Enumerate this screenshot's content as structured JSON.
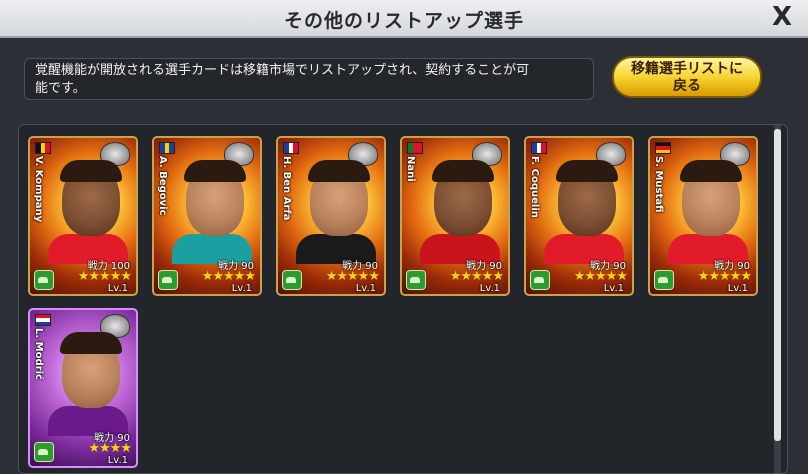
{
  "header": {
    "title": "その他のリストアップ選手",
    "close_label": "X"
  },
  "info": {
    "text_line1": "覚醒機能が開放される選手カードは移籍市場でリストアップされ、契約することが可",
    "text_line2": "能です。"
  },
  "back_button": {
    "line1": "移籍選手リストに",
    "line2": "戻る"
  },
  "cards": [
    {
      "name": "V. Kompany",
      "power": "戦力 100",
      "stars": "★★★★★",
      "level": "Lv.1",
      "flag": [
        "#111111",
        "#f5d400",
        "#e0102a"
      ],
      "flag_dir": "v",
      "style": "gold",
      "skin": "dark",
      "shirt": "#e21b2a"
    },
    {
      "name": "A. Begovic",
      "power": "戦力 90",
      "stars": "★★★★★",
      "level": "Lv.1",
      "flag": [
        "#1c3ea0",
        "#f5d400",
        "#1c3ea0"
      ],
      "flag_dir": "v",
      "style": "gold",
      "skin": "light",
      "shirt": "#1aa0a0"
    },
    {
      "name": "H. Ben Arfa",
      "power": "戦力 90",
      "stars": "★★★★★",
      "level": "Lv.1",
      "flag": [
        "#1c3ea0",
        "#ffffff",
        "#e0102a"
      ],
      "flag_dir": "v",
      "style": "gold",
      "skin": "light",
      "shirt": "#1a1a1a"
    },
    {
      "name": "Nani",
      "power": "戦力 90",
      "stars": "★★★★★",
      "level": "Lv.1",
      "flag": [
        "#0a7a2a",
        "#e0102a",
        "#e0102a"
      ],
      "flag_dir": "v",
      "style": "gold",
      "skin": "dark",
      "shirt": "#c8141a"
    },
    {
      "name": "F. Coquelin",
      "power": "戦力 90",
      "stars": "★★★★★",
      "level": "Lv.1",
      "flag": [
        "#1c3ea0",
        "#ffffff",
        "#e0102a"
      ],
      "flag_dir": "v",
      "style": "gold",
      "skin": "dark",
      "shirt": "#e21b2a"
    },
    {
      "name": "S. Mustafi",
      "power": "戦力 90",
      "stars": "★★★★★",
      "level": "Lv.1",
      "flag": [
        "#111111",
        "#e0102a",
        "#f5c400"
      ],
      "flag_dir": "h",
      "style": "gold",
      "skin": "light",
      "shirt": "#e21b2a"
    },
    {
      "name": "L. Modrić",
      "power": "戦力 90",
      "stars": "★★★★",
      "level": "Lv.1",
      "flag": [
        "#e0102a",
        "#ffffff",
        "#1c3ea0"
      ],
      "flag_dir": "h",
      "style": "purple",
      "skin": "light",
      "shirt": "#6a1a8a"
    }
  ],
  "colors": {
    "background": "#2c3036",
    "panel": "#22262b",
    "button_gold": "#f5cf2a",
    "star": "#ffd21a"
  }
}
